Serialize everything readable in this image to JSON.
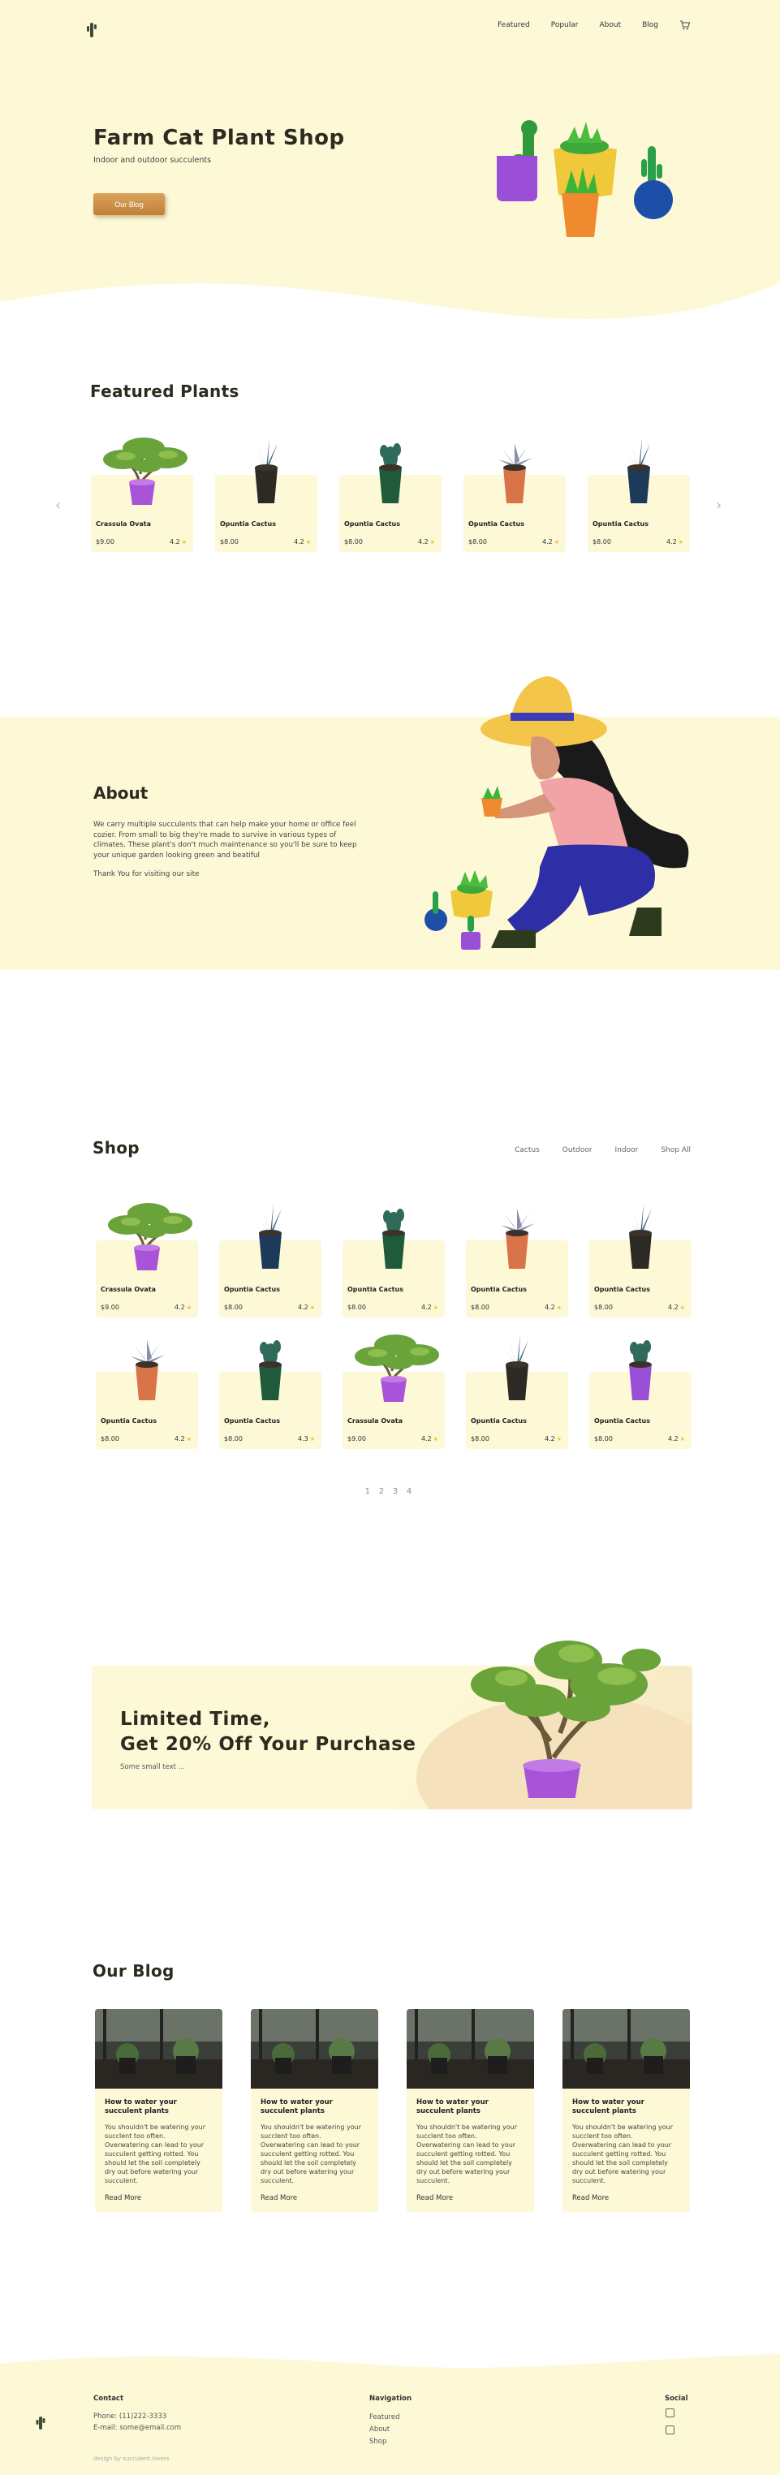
{
  "colors": {
    "cream": "#fdf8d6",
    "accent": "#c98a45",
    "star": "#f2c12e",
    "text": "#2b2b20"
  },
  "header": {
    "logo_icon": "cactus-logo-icon",
    "nav": [
      "Featured",
      "Popular",
      "About",
      "Blog"
    ],
    "cart_icon": "cart-icon"
  },
  "hero": {
    "title": "Farm Cat Plant Shop",
    "subtitle": "Indoor and outdoor succulents",
    "button": "Our Blog"
  },
  "featured": {
    "title": "Featured Plants",
    "prev_icon": "chevron-left-icon",
    "next_icon": "chevron-right-icon",
    "items": [
      {
        "name": "Crassula Ovata",
        "price": "$9.00",
        "rating": "4.2"
      },
      {
        "name": "Opuntia Cactus",
        "price": "$8.00",
        "rating": "4.2"
      },
      {
        "name": "Opuntia Cactus",
        "price": "$8.00",
        "rating": "4.2"
      },
      {
        "name": "Opuntia Cactus",
        "price": "$8.00",
        "rating": "4.2"
      },
      {
        "name": "Opuntia Cactus",
        "price": "$8.00",
        "rating": "4.2"
      }
    ]
  },
  "about": {
    "title": "About",
    "body": "We carry multiple succulents that can help make your home or office feel cozier. From small to big they're made to survive in various types of climates. These plant's don't much maintenance so you'll be sure to keep your unique garden looking green and beatiful",
    "thanks": "Thank You for visiting our site"
  },
  "shop": {
    "title": "Shop",
    "filters": [
      "Cactus",
      "Outdoor",
      "Indoor",
      "Shop All"
    ],
    "row1": [
      {
        "name": "Crassula Ovata",
        "price": "$9.00",
        "rating": "4.2"
      },
      {
        "name": "Opuntia Cactus",
        "price": "$8.00",
        "rating": "4.2"
      },
      {
        "name": "Opuntia Cactus",
        "price": "$8.00",
        "rating": "4.2"
      },
      {
        "name": "Opuntia Cactus",
        "price": "$8.00",
        "rating": "4.2"
      },
      {
        "name": "Opuntia Cactus",
        "price": "$8.00",
        "rating": "4.2"
      }
    ],
    "row2": [
      {
        "name": "Opuntia Cactus",
        "price": "$8.00",
        "rating": "4.2"
      },
      {
        "name": "Opuntia Cactus",
        "price": "$8.00",
        "rating": "4.3"
      },
      {
        "name": "Crassula Ovata",
        "price": "$9.00",
        "rating": "4.2"
      },
      {
        "name": "Opuntia Cactus",
        "price": "$8.00",
        "rating": "4.2"
      },
      {
        "name": "Opuntia Cactus",
        "price": "$8.00",
        "rating": "4.2"
      }
    ],
    "pages": [
      "1",
      "2",
      "3",
      "4"
    ]
  },
  "promo": {
    "line1": "Limited Time,",
    "line2": "Get 20% Off Your Purchase",
    "small": "Some small text ..."
  },
  "blog": {
    "title": "Our Blog",
    "posts": [
      {
        "title": "How to water your succulent plants",
        "body": "You shouldn't be watering your succlent too often. Overwatering can lead to your succulent getting rotted. You should let the soil completely dry out before watering your succulent.",
        "more": "Read More"
      },
      {
        "title": "How to water your succulent plants",
        "body": "You shouldn't be watering your succlent too often. Overwatering can lead to your succulent getting rotted. You should let the soil completely dry out before watering your succulent.",
        "more": "Read More"
      },
      {
        "title": "How to water your succulent plants",
        "body": "You shouldn't be watering your succlent too often. Overwatering can lead to your succulent getting rotted. You should let the soil completely dry out before watering your succulent.",
        "more": "Read More"
      },
      {
        "title": "How to water your succulent plants",
        "body": "You shouldn't be watering your succlent too often. Overwatering can lead to your succulent getting rotted. You should let the soil completely dry out before watering your succulent.",
        "more": "Read More"
      }
    ]
  },
  "footer": {
    "contact_title": "Contact",
    "phone": "Phone: (11)222-3333",
    "email": "E-mail: some@email.com",
    "nav_title": "Navigation",
    "nav_links": [
      "Featured",
      "About",
      "Shop"
    ],
    "social_title": "Social",
    "social_icons": [
      "instagram-icon",
      "facebook-icon"
    ],
    "credit": "design by succulent.lovers"
  }
}
